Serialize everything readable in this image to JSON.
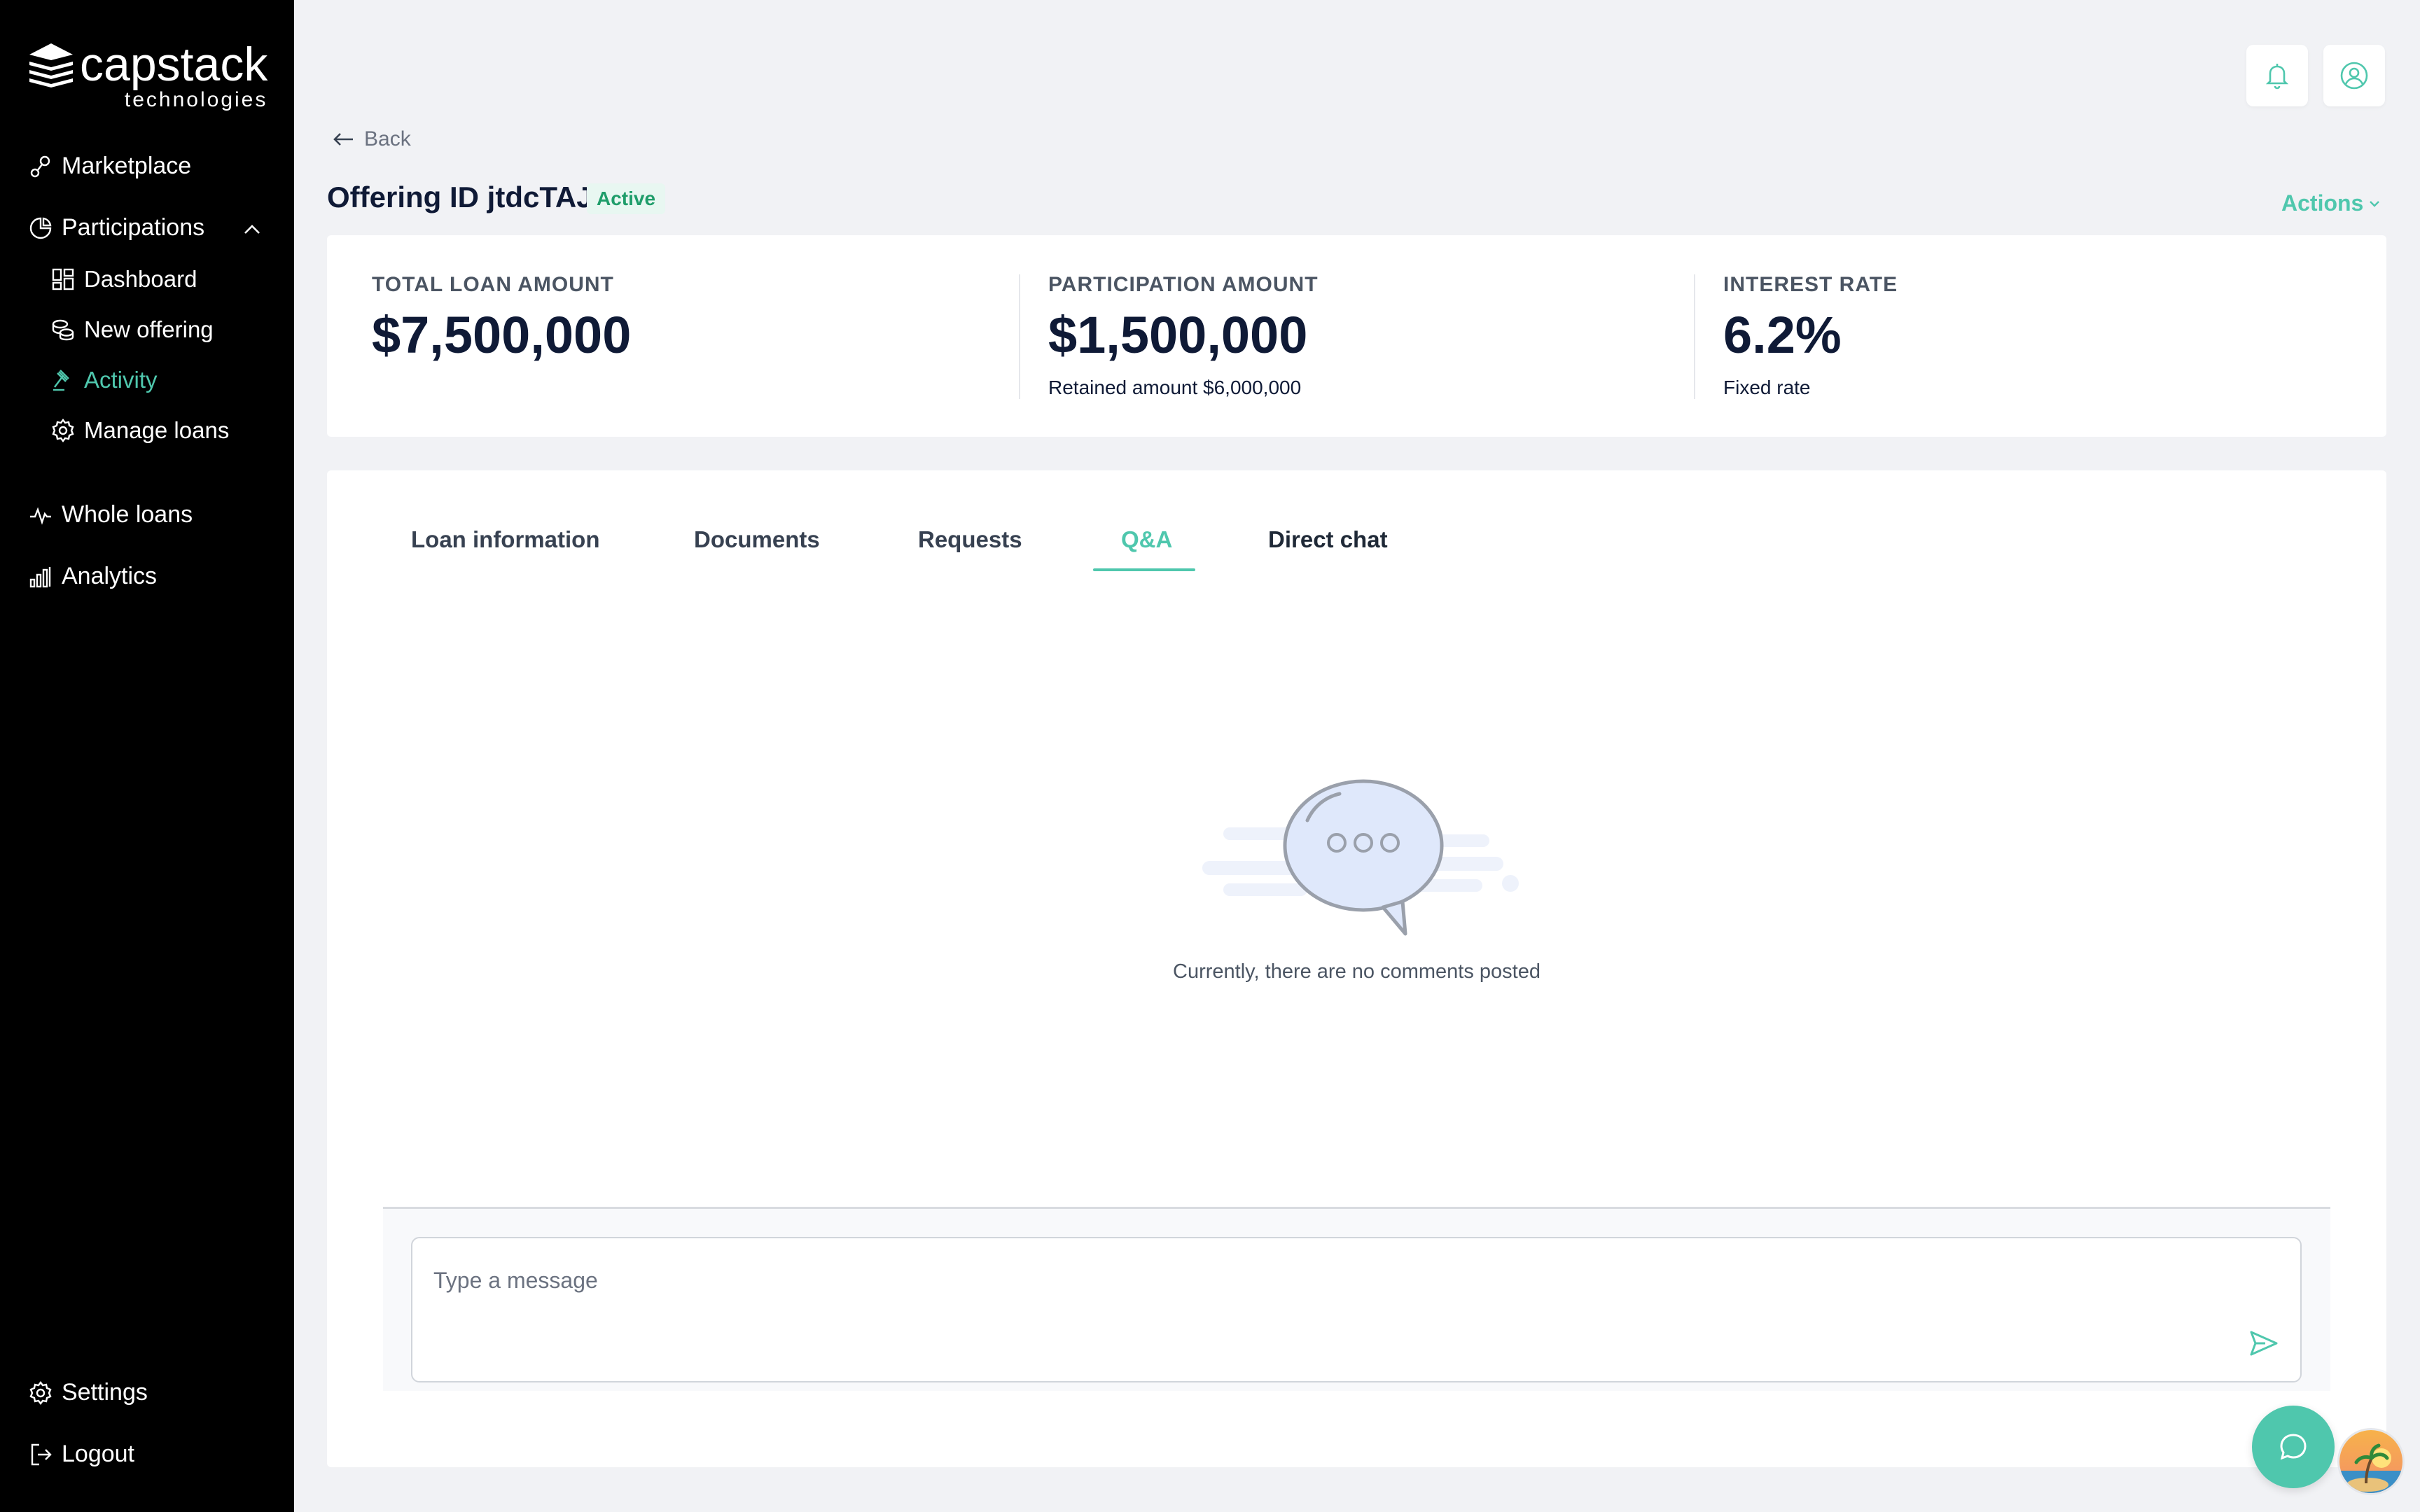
{
  "brand": {
    "name": "capstack",
    "sub": "technologies"
  },
  "sidebar": {
    "items": [
      {
        "label": "Marketplace",
        "icon": "marketplace-icon"
      },
      {
        "label": "Participations",
        "icon": "pie-chart-icon"
      },
      {
        "label": "Dashboard",
        "icon": "dashboard-icon"
      },
      {
        "label": "New offering",
        "icon": "coins-icon"
      },
      {
        "label": "Activity",
        "icon": "gavel-icon"
      },
      {
        "label": "Manage loans",
        "icon": "gear-icon"
      },
      {
        "label": "Whole loans",
        "icon": "pulse-icon"
      },
      {
        "label": "Analytics",
        "icon": "bar-chart-icon"
      }
    ],
    "footer": [
      {
        "label": "Settings",
        "icon": "gear-icon"
      },
      {
        "label": "Logout",
        "icon": "logout-icon"
      }
    ]
  },
  "header": {
    "back_label": "Back",
    "offering_title": "Offering ID jtdcTAJI",
    "status": "Active",
    "actions_label": "Actions"
  },
  "summary": {
    "total_loan": {
      "label": "TOTAL LOAN AMOUNT",
      "value": "$7,500,000"
    },
    "participation": {
      "label": "PARTICIPATION AMOUNT",
      "value": "$1,500,000",
      "sub": "Retained amount $6,000,000"
    },
    "interest": {
      "label": "INTEREST RATE",
      "value": "6.2%",
      "sub": "Fixed rate"
    }
  },
  "tabs": [
    {
      "label": "Loan information"
    },
    {
      "label": "Documents"
    },
    {
      "label": "Requests"
    },
    {
      "label": "Q&A"
    },
    {
      "label": "Direct chat"
    }
  ],
  "active_tab": "Q&A",
  "empty_state": {
    "message": "Currently, there are no comments posted"
  },
  "composer": {
    "placeholder": "Type a message",
    "value": ""
  },
  "colors": {
    "accent": "#4fc7ad",
    "sidebar_bg": "#000000",
    "page_bg": "#f1f2f5",
    "active_badge": "#1f9d6a"
  }
}
